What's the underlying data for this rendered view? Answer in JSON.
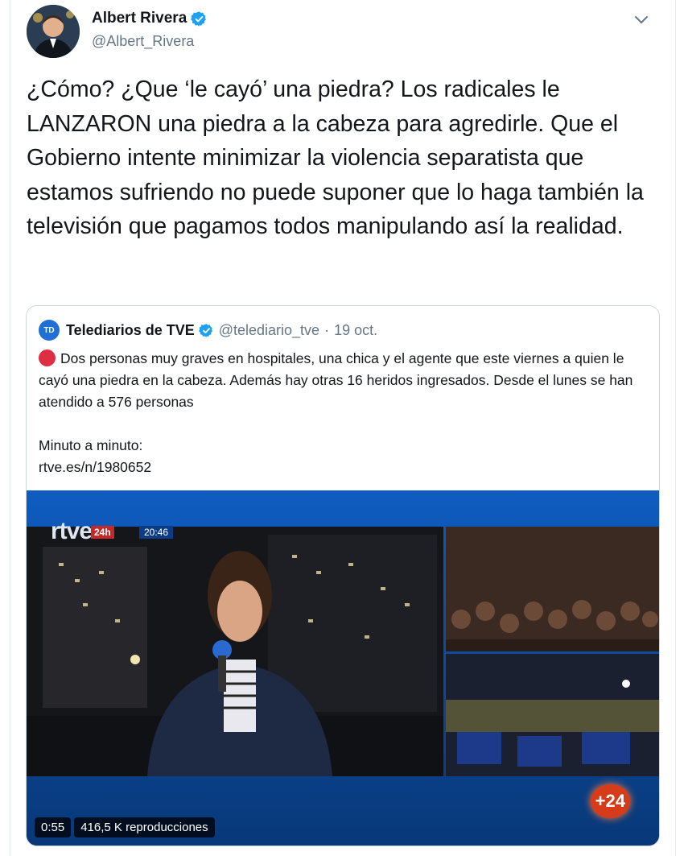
{
  "author": {
    "name": "Albert Rivera",
    "handle": "@Albert_Rivera",
    "verified_icon": "verified-badge-icon"
  },
  "menu_icon": "chevron-down-icon",
  "tweet": {
    "text": "¿Cómo? ¿Que ‘le cayó’ una piedra? Los radicales le LANZARON una piedra a la cabeza para agredirle. Que el Gobierno intente minimizar la violencia separatista que estamos sufriendo no puede suponer que lo haga también la televisión que pagamos todos manipulando así la realidad."
  },
  "quoted": {
    "logo_text": "TD",
    "name": "Telediarios de TVE",
    "handle": "@telediario_tve",
    "separator": "·",
    "date": "19 oct.",
    "body": "Dos personas muy graves en hospitales, una chica y el agente que este viernes a quien le cayó una piedra en la cabeza. Además hay otras 16 heridos ingresados. Desde el lunes se han atendido a 576 personas",
    "link_label": "Minuto a minuto:",
    "link": "rtve.es/n/1980652",
    "accent_color": "#dd2e44"
  },
  "video": {
    "channel_logo": "rtve",
    "live_badge": "24h",
    "clock": "20:46",
    "corner_badge": "+24",
    "duration": "0:55",
    "views": "416,5 K reproducciones"
  },
  "colors": {
    "verified": "#1da1f2",
    "secondary_text": "#657786",
    "video_blue": "#0b4aa0"
  }
}
